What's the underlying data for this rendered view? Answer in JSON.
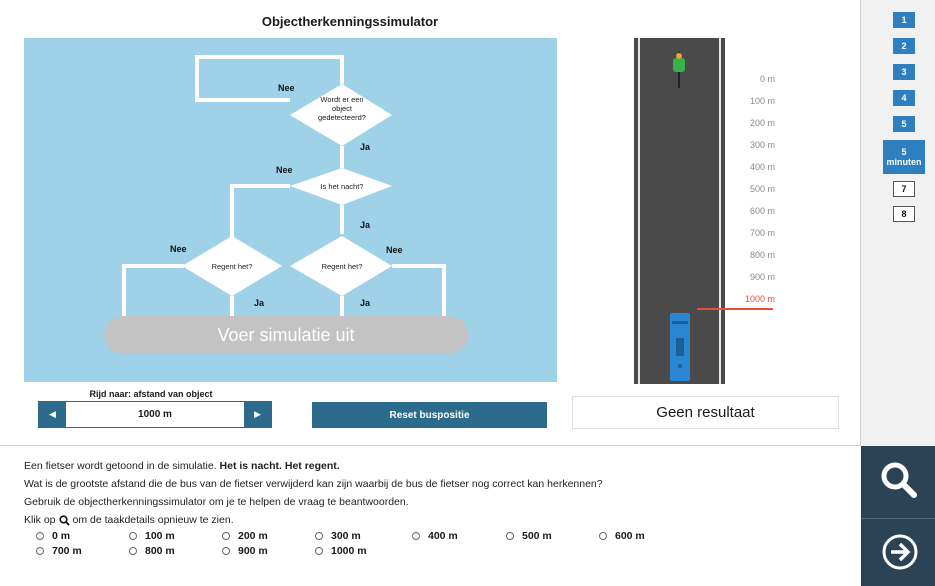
{
  "title": "Objectherkenningssimulator",
  "flowchart": {
    "q1": [
      "Wordt er een",
      "object",
      "gedetecteerd?"
    ],
    "q2": "Is het nacht?",
    "q3a": "Regent het?",
    "q3b": "Regent het?",
    "yes": "Ja",
    "no": "Nee",
    "run_button": "Voer simulatie uit"
  },
  "controls": {
    "nav_label": "Rijd naar: afstand van object",
    "value": "1000 m",
    "prev_icon": "◀",
    "next_icon": "▶",
    "reset_label": "Reset buspositie",
    "result": "Geen resultaat"
  },
  "road": {
    "distances": [
      "0 m",
      "100 m",
      "200 m",
      "300 m",
      "400 m",
      "500 m",
      "600 m",
      "700 m",
      "800 m",
      "900 m",
      "1000 m"
    ],
    "highlight_index": 10,
    "highlight_color": "#e74c3c"
  },
  "questions": {
    "items": [
      "1",
      "2",
      "3",
      "4",
      "5"
    ],
    "active_number": "5",
    "active_label": "minuten",
    "later": [
      "7",
      "8"
    ]
  },
  "sidebar_icons": [
    "search-icon",
    "next-arrow-icon"
  ],
  "task": {
    "line1_plain": "Een fietser wordt getoond in de simulatie.",
    "line1_bold": "Het is nacht. Het regent.",
    "line2": "Wat is de grootste afstand die de bus van de fietser verwijderd kan zijn waarbij de bus de fietser nog correct kan herkennen?",
    "line3": "Gebruik de objectherkenningssimulator om je te helpen de vraag te beantwoorden.",
    "line4_a": "Klik op",
    "line4_b": "om de taakdetails opnieuw te zien.",
    "options": [
      "0 m",
      "100 m",
      "200 m",
      "300 m",
      "400 m",
      "500 m",
      "600 m",
      "700 m",
      "800 m",
      "900 m",
      "1000 m"
    ]
  },
  "colors": {
    "accent": "#2d6b8c",
    "quiz_blue": "#2d7fbf",
    "flow_bg": "#9fd2e8",
    "sidebar_dark": "#2b4354"
  }
}
